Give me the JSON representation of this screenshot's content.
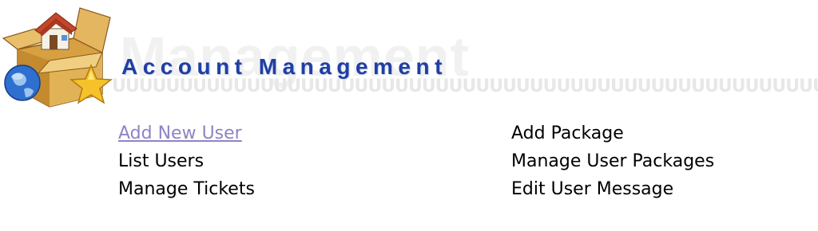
{
  "header": {
    "title": "Account Management",
    "watermark": "Management",
    "decor_pattern": "UUUUUUUUUUUUUUUUUUUUUUUUUUUUUUUUUUUUUUUUUUUUUUUUUUUUUUUU",
    "logo_icon": "package-home-globe-star-icon"
  },
  "links": {
    "left": [
      {
        "label": "Add New User"
      },
      {
        "label": "List Users"
      },
      {
        "label": "Manage Tickets"
      }
    ],
    "right": [
      {
        "label": "Add Package"
      },
      {
        "label": "Manage User Packages"
      },
      {
        "label": "Edit User Message"
      }
    ]
  },
  "colors": {
    "title": "#1f3fa3",
    "link": "#000000",
    "link_active": "#8d84c6"
  }
}
